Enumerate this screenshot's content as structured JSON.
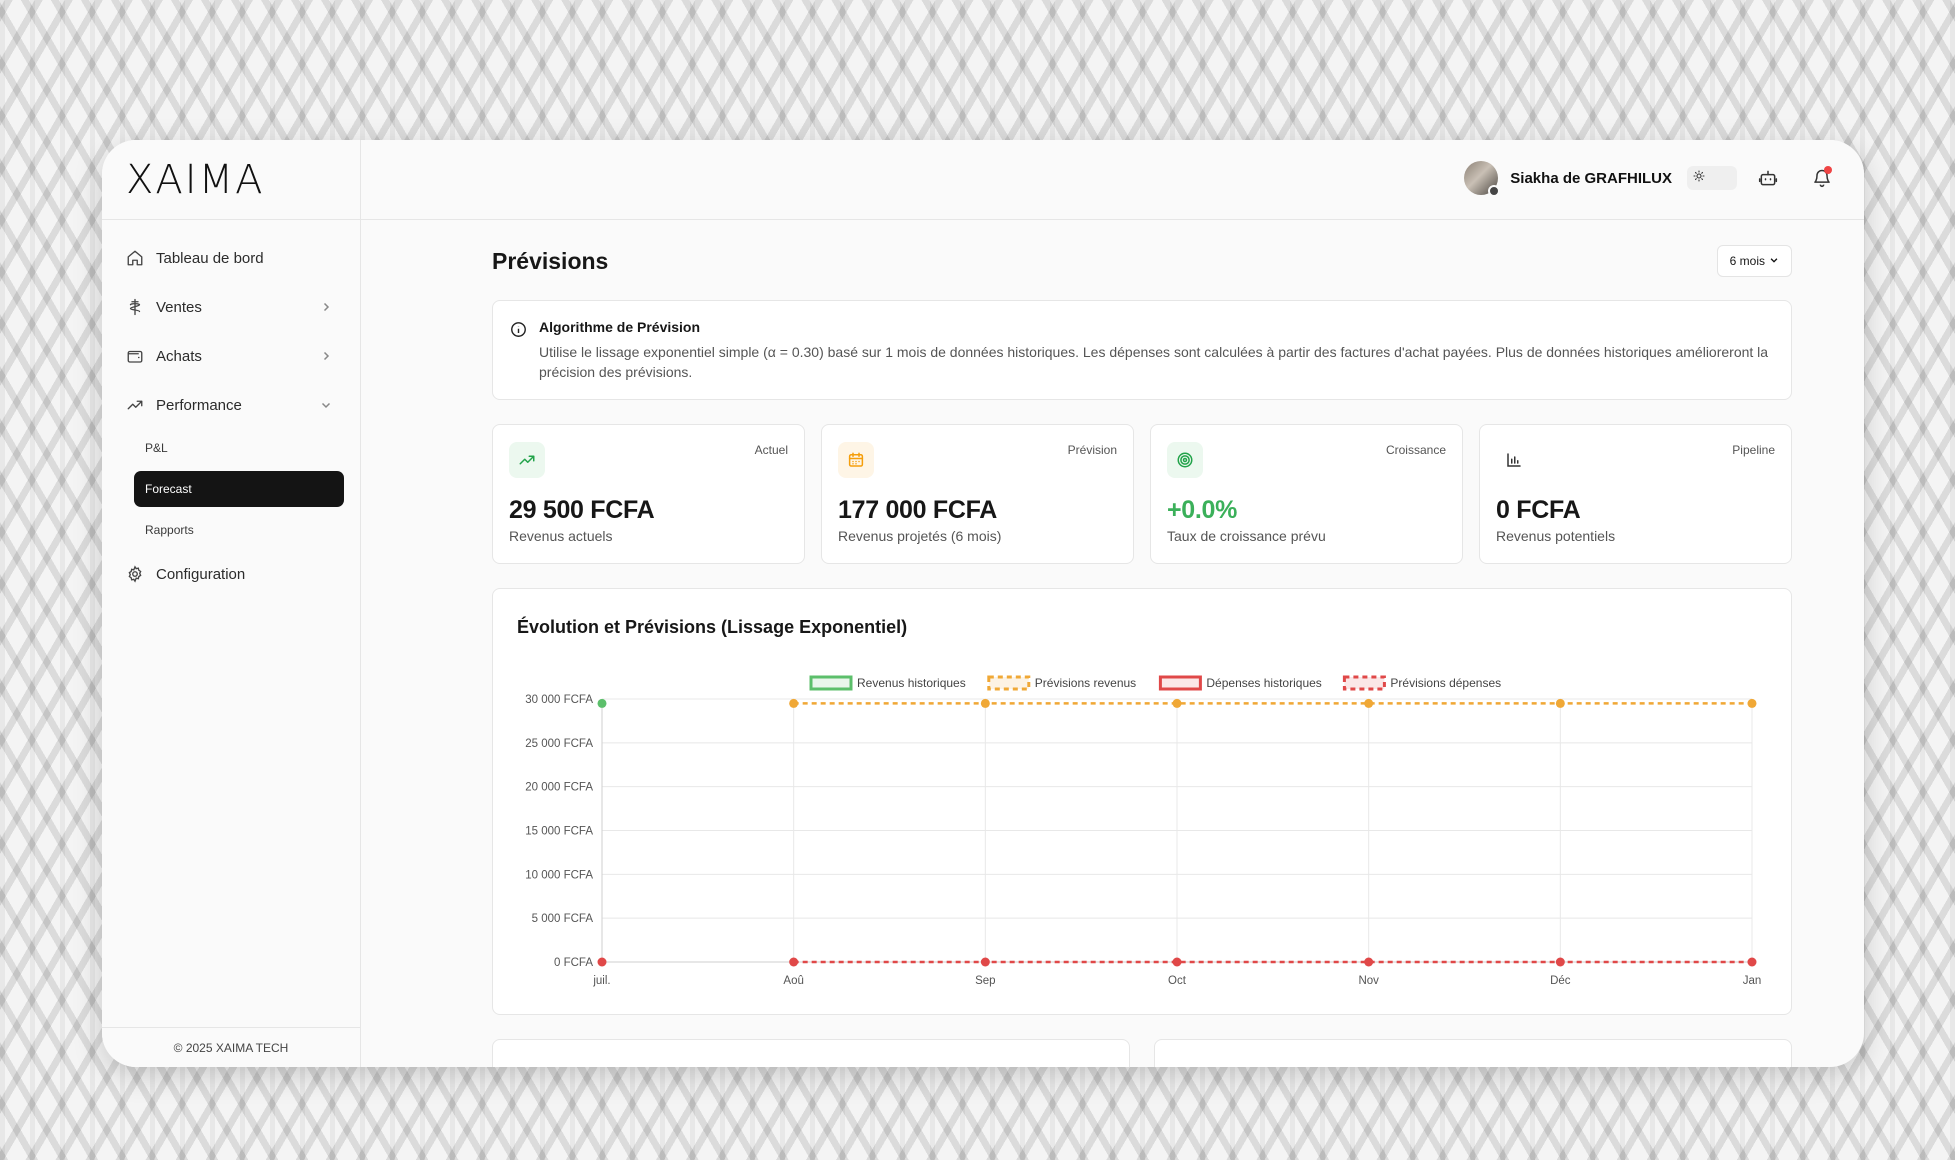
{
  "brand": {
    "logo_text": "XAIMA"
  },
  "sidebar": {
    "items": [
      {
        "label": "Tableau de bord",
        "icon": "home-icon"
      },
      {
        "label": "Ventes",
        "icon": "caduceus-icon"
      },
      {
        "label": "Achats",
        "icon": "wallet-icon"
      },
      {
        "label": "Performance",
        "icon": "trending-up-icon"
      }
    ],
    "sub_items": [
      {
        "label": "P&L"
      },
      {
        "label": "Forecast"
      },
      {
        "label": "Rapports"
      }
    ],
    "config_label": "Configuration",
    "footer": "© 2025 XAIMA TECH"
  },
  "header": {
    "user_name": "Siakha de GRAFHILUX"
  },
  "page": {
    "title": "Prévisions",
    "period": "6 mois"
  },
  "info": {
    "title": "Algorithme de Prévision",
    "text": "Utilise le lissage exponentiel simple (α = 0.30) basé sur 1 mois de données historiques. Les dépenses sont calculées à partir des factures d'achat payées. Plus de données historiques amélioreront la précision des prévisions."
  },
  "cards": [
    {
      "tag": "Actuel",
      "value": "29 500 FCFA",
      "label": "Revenus actuels",
      "icon": "trending-up-icon",
      "accent": "#22a34a",
      "bg": "#ecf8ef"
    },
    {
      "tag": "Prévision",
      "value": "177 000 FCFA",
      "label": "Revenus projetés (6 mois)",
      "icon": "calendar-icon",
      "accent": "#f59e0b",
      "bg": "#fef5e6"
    },
    {
      "tag": "Croissance",
      "value": "+0.0%",
      "label": "Taux de croissance prévu",
      "icon": "target-icon",
      "accent": "#22a34a",
      "bg": "#ecf8ef"
    },
    {
      "tag": "Pipeline",
      "value": "0 FCFA",
      "label": "Revenus potentiels",
      "icon": "bar-chart-icon",
      "accent": "#444444",
      "bg": "#ffffff"
    }
  ],
  "chart_data": {
    "type": "line",
    "title": "Évolution et Prévisions (Lissage Exponentiel)",
    "categories": [
      "juil.",
      "Aoû",
      "Sep",
      "Oct",
      "Nov",
      "Déc",
      "Jan"
    ],
    "ylim": [
      0,
      30000
    ],
    "yticks": [
      "0 FCFA",
      "5 000 FCFA",
      "10 000 FCFA",
      "15 000 FCFA",
      "20 000 FCFA",
      "25 000 FCFA",
      "30 000 FCFA"
    ],
    "ytick_values": [
      0,
      5000,
      10000,
      15000,
      20000,
      25000,
      30000
    ],
    "grid": true,
    "legend_position": "top",
    "series": [
      {
        "name": "Revenus historiques",
        "values": [
          29500,
          null,
          null,
          null,
          null,
          null,
          null
        ],
        "color": "#5cbf6b",
        "dashed": false
      },
      {
        "name": "Prévisions revenus",
        "values": [
          null,
          29500,
          29500,
          29500,
          29500,
          29500,
          29500
        ],
        "color": "#f0a836",
        "dashed": true
      },
      {
        "name": "Dépenses historiques",
        "values": [
          0,
          null,
          null,
          null,
          null,
          null,
          null
        ],
        "color": "#e04848",
        "dashed": false
      },
      {
        "name": "Prévisions dépenses",
        "values": [
          null,
          0,
          0,
          0,
          0,
          0,
          0
        ],
        "color": "#e04848",
        "dashed": true
      }
    ]
  }
}
